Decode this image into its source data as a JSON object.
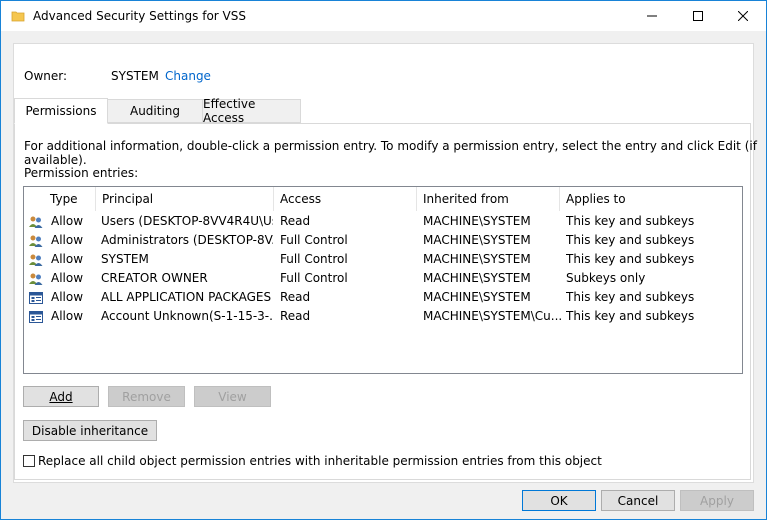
{
  "window": {
    "title": "Advanced Security Settings for VSS"
  },
  "owner": {
    "label": "Owner:",
    "value": "SYSTEM",
    "change_link": "Change"
  },
  "tabs": [
    {
      "label": "Permissions",
      "active": true
    },
    {
      "label": "Auditing",
      "active": false
    },
    {
      "label": "Effective Access",
      "active": false
    }
  ],
  "info_text": "For additional information, double-click a permission entry. To modify a permission entry, select the entry and click Edit (if available).",
  "entries_label": "Permission entries:",
  "columns": [
    "Type",
    "Principal",
    "Access",
    "Inherited from",
    "Applies to"
  ],
  "entries": [
    {
      "icon": "users-icon",
      "type": "Allow",
      "principal": "Users (DESKTOP-8VV4R4U\\Us...",
      "access": "Read",
      "inherited_from": "MACHINE\\SYSTEM",
      "applies_to": "This key and subkeys"
    },
    {
      "icon": "users-icon",
      "type": "Allow",
      "principal": "Administrators (DESKTOP-8V...",
      "access": "Full Control",
      "inherited_from": "MACHINE\\SYSTEM",
      "applies_to": "This key and subkeys"
    },
    {
      "icon": "users-icon",
      "type": "Allow",
      "principal": "SYSTEM",
      "access": "Full Control",
      "inherited_from": "MACHINE\\SYSTEM",
      "applies_to": "This key and subkeys"
    },
    {
      "icon": "users-icon",
      "type": "Allow",
      "principal": "CREATOR OWNER",
      "access": "Full Control",
      "inherited_from": "MACHINE\\SYSTEM",
      "applies_to": "Subkeys only"
    },
    {
      "icon": "app-package-icon",
      "type": "Allow",
      "principal": "ALL APPLICATION PACKAGES",
      "access": "Read",
      "inherited_from": "MACHINE\\SYSTEM",
      "applies_to": "This key and subkeys"
    },
    {
      "icon": "app-package-icon",
      "type": "Allow",
      "principal": "Account Unknown(S-1-15-3-...",
      "access": "Read",
      "inherited_from": "MACHINE\\SYSTEM\\Cu...",
      "applies_to": "This key and subkeys"
    }
  ],
  "buttons": {
    "add": "Add",
    "remove": "Remove",
    "view": "View",
    "disable_inheritance": "Disable inheritance",
    "ok": "OK",
    "cancel": "Cancel",
    "apply": "Apply"
  },
  "replace_checkbox": {
    "label": "Replace all child object permission entries with inheritable permission entries from this object",
    "checked": false
  },
  "colors": {
    "accent": "#0078d7",
    "link": "#0066cc"
  }
}
